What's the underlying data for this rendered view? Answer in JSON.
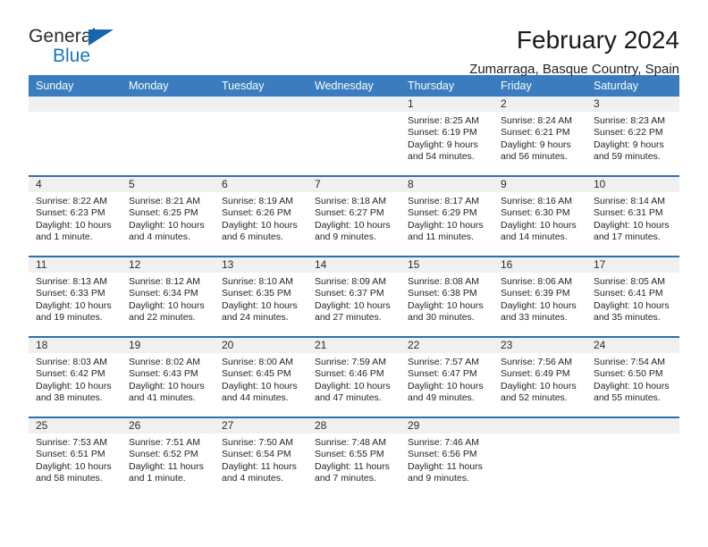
{
  "brand": {
    "word_one": "General",
    "word_two": "Blue",
    "accent_color": "#1776bf",
    "triangle_color": "#1565b0",
    "triangle_icon": "triangle-icon"
  },
  "header": {
    "title": "February 2024",
    "location": "Zumarraga, Basque Country, Spain"
  },
  "calendar": {
    "header_bg": "#3a7cbe",
    "row_divider_color": "#2f6fb0",
    "daynum_strip_bg": "#f0f0f0",
    "weekdays": [
      "Sunday",
      "Monday",
      "Tuesday",
      "Wednesday",
      "Thursday",
      "Friday",
      "Saturday"
    ],
    "weeks": [
      [
        {
          "day": "",
          "empty": true
        },
        {
          "day": "",
          "empty": true
        },
        {
          "day": "",
          "empty": true
        },
        {
          "day": "",
          "empty": true
        },
        {
          "day": "1",
          "sunrise": "Sunrise: 8:25 AM",
          "sunset": "Sunset: 6:19 PM",
          "daylight": "Daylight: 9 hours and 54 minutes."
        },
        {
          "day": "2",
          "sunrise": "Sunrise: 8:24 AM",
          "sunset": "Sunset: 6:21 PM",
          "daylight": "Daylight: 9 hours and 56 minutes."
        },
        {
          "day": "3",
          "sunrise": "Sunrise: 8:23 AM",
          "sunset": "Sunset: 6:22 PM",
          "daylight": "Daylight: 9 hours and 59 minutes."
        }
      ],
      [
        {
          "day": "4",
          "sunrise": "Sunrise: 8:22 AM",
          "sunset": "Sunset: 6:23 PM",
          "daylight": "Daylight: 10 hours and 1 minute."
        },
        {
          "day": "5",
          "sunrise": "Sunrise: 8:21 AM",
          "sunset": "Sunset: 6:25 PM",
          "daylight": "Daylight: 10 hours and 4 minutes."
        },
        {
          "day": "6",
          "sunrise": "Sunrise: 8:19 AM",
          "sunset": "Sunset: 6:26 PM",
          "daylight": "Daylight: 10 hours and 6 minutes."
        },
        {
          "day": "7",
          "sunrise": "Sunrise: 8:18 AM",
          "sunset": "Sunset: 6:27 PM",
          "daylight": "Daylight: 10 hours and 9 minutes."
        },
        {
          "day": "8",
          "sunrise": "Sunrise: 8:17 AM",
          "sunset": "Sunset: 6:29 PM",
          "daylight": "Daylight: 10 hours and 11 minutes."
        },
        {
          "day": "9",
          "sunrise": "Sunrise: 8:16 AM",
          "sunset": "Sunset: 6:30 PM",
          "daylight": "Daylight: 10 hours and 14 minutes."
        },
        {
          "day": "10",
          "sunrise": "Sunrise: 8:14 AM",
          "sunset": "Sunset: 6:31 PM",
          "daylight": "Daylight: 10 hours and 17 minutes."
        }
      ],
      [
        {
          "day": "11",
          "sunrise": "Sunrise: 8:13 AM",
          "sunset": "Sunset: 6:33 PM",
          "daylight": "Daylight: 10 hours and 19 minutes."
        },
        {
          "day": "12",
          "sunrise": "Sunrise: 8:12 AM",
          "sunset": "Sunset: 6:34 PM",
          "daylight": "Daylight: 10 hours and 22 minutes."
        },
        {
          "day": "13",
          "sunrise": "Sunrise: 8:10 AM",
          "sunset": "Sunset: 6:35 PM",
          "daylight": "Daylight: 10 hours and 24 minutes."
        },
        {
          "day": "14",
          "sunrise": "Sunrise: 8:09 AM",
          "sunset": "Sunset: 6:37 PM",
          "daylight": "Daylight: 10 hours and 27 minutes."
        },
        {
          "day": "15",
          "sunrise": "Sunrise: 8:08 AM",
          "sunset": "Sunset: 6:38 PM",
          "daylight": "Daylight: 10 hours and 30 minutes."
        },
        {
          "day": "16",
          "sunrise": "Sunrise: 8:06 AM",
          "sunset": "Sunset: 6:39 PM",
          "daylight": "Daylight: 10 hours and 33 minutes."
        },
        {
          "day": "17",
          "sunrise": "Sunrise: 8:05 AM",
          "sunset": "Sunset: 6:41 PM",
          "daylight": "Daylight: 10 hours and 35 minutes."
        }
      ],
      [
        {
          "day": "18",
          "sunrise": "Sunrise: 8:03 AM",
          "sunset": "Sunset: 6:42 PM",
          "daylight": "Daylight: 10 hours and 38 minutes."
        },
        {
          "day": "19",
          "sunrise": "Sunrise: 8:02 AM",
          "sunset": "Sunset: 6:43 PM",
          "daylight": "Daylight: 10 hours and 41 minutes."
        },
        {
          "day": "20",
          "sunrise": "Sunrise: 8:00 AM",
          "sunset": "Sunset: 6:45 PM",
          "daylight": "Daylight: 10 hours and 44 minutes."
        },
        {
          "day": "21",
          "sunrise": "Sunrise: 7:59 AM",
          "sunset": "Sunset: 6:46 PM",
          "daylight": "Daylight: 10 hours and 47 minutes."
        },
        {
          "day": "22",
          "sunrise": "Sunrise: 7:57 AM",
          "sunset": "Sunset: 6:47 PM",
          "daylight": "Daylight: 10 hours and 49 minutes."
        },
        {
          "day": "23",
          "sunrise": "Sunrise: 7:56 AM",
          "sunset": "Sunset: 6:49 PM",
          "daylight": "Daylight: 10 hours and 52 minutes."
        },
        {
          "day": "24",
          "sunrise": "Sunrise: 7:54 AM",
          "sunset": "Sunset: 6:50 PM",
          "daylight": "Daylight: 10 hours and 55 minutes."
        }
      ],
      [
        {
          "day": "25",
          "sunrise": "Sunrise: 7:53 AM",
          "sunset": "Sunset: 6:51 PM",
          "daylight": "Daylight: 10 hours and 58 minutes."
        },
        {
          "day": "26",
          "sunrise": "Sunrise: 7:51 AM",
          "sunset": "Sunset: 6:52 PM",
          "daylight": "Daylight: 11 hours and 1 minute."
        },
        {
          "day": "27",
          "sunrise": "Sunrise: 7:50 AM",
          "sunset": "Sunset: 6:54 PM",
          "daylight": "Daylight: 11 hours and 4 minutes."
        },
        {
          "day": "28",
          "sunrise": "Sunrise: 7:48 AM",
          "sunset": "Sunset: 6:55 PM",
          "daylight": "Daylight: 11 hours and 7 minutes."
        },
        {
          "day": "29",
          "sunrise": "Sunrise: 7:46 AM",
          "sunset": "Sunset: 6:56 PM",
          "daylight": "Daylight: 11 hours and 9 minutes."
        },
        {
          "day": "",
          "empty": true
        },
        {
          "day": "",
          "empty": true
        }
      ]
    ]
  }
}
